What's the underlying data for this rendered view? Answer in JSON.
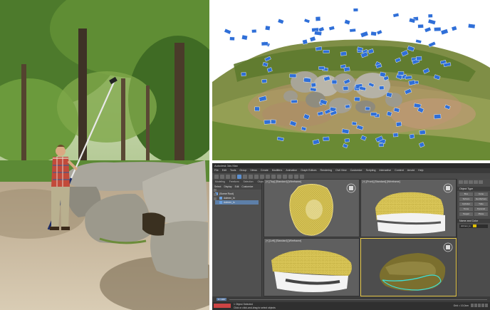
{
  "app": {
    "title": "Autodesk 3ds Max",
    "menu": [
      "File",
      "Edit",
      "Tools",
      "Group",
      "Views",
      "Create",
      "Modifiers",
      "Animation",
      "Graph Editors",
      "Rendering",
      "Civil View",
      "Customize",
      "Scripting",
      "Interactive",
      "Content",
      "Arnold",
      "Help"
    ],
    "ribbon_tabs": [
      "Modeling",
      "Freeform",
      "Selection",
      "Object Paint",
      "Populate"
    ]
  },
  "scene_explorer": {
    "tabs": [
      "Select",
      "Display",
      "Edit",
      "Customize"
    ],
    "items": [
      {
        "label": "(Scene Root)",
        "selected": false,
        "indent": false
      },
      {
        "label": "dolmen_hi",
        "selected": false,
        "indent": true
      },
      {
        "label": "dolmen_lo",
        "selected": true,
        "indent": true
      }
    ]
  },
  "viewports": {
    "top": {
      "label": "[+] [Top] [Standard] [Wireframe]"
    },
    "front": {
      "label": "[+] [Front] [Standard] [Wireframe]"
    },
    "left": {
      "label": "[+] [Left] [Standard] [Wireframe]"
    },
    "perspective": {
      "label": "[+] [Perspective] [Standard] [Default Shading]"
    }
  },
  "command_panel": {
    "rollout_object_type": "Object Type",
    "buttons": [
      "Box",
      "Cone",
      "Sphere",
      "GeoSphere",
      "Cylinder",
      "Tube",
      "Torus",
      "Pyramid",
      "Teapot",
      "Plane"
    ],
    "rollout_name_color": "Name and Color",
    "object_name": "dolmen_lo",
    "object_color": "#e0c000"
  },
  "timeline": {
    "slider": "0 / 100"
  },
  "status": {
    "selection": "1 Object Selected",
    "prompt": "Click or click-and-drag to select objects",
    "grid": "Grid = 10,0cm"
  },
  "colors": {
    "selection_yellow": "#e6c84a",
    "highres_mesh": "#e8e8e8",
    "camera_blue": "#2f6fd8"
  }
}
